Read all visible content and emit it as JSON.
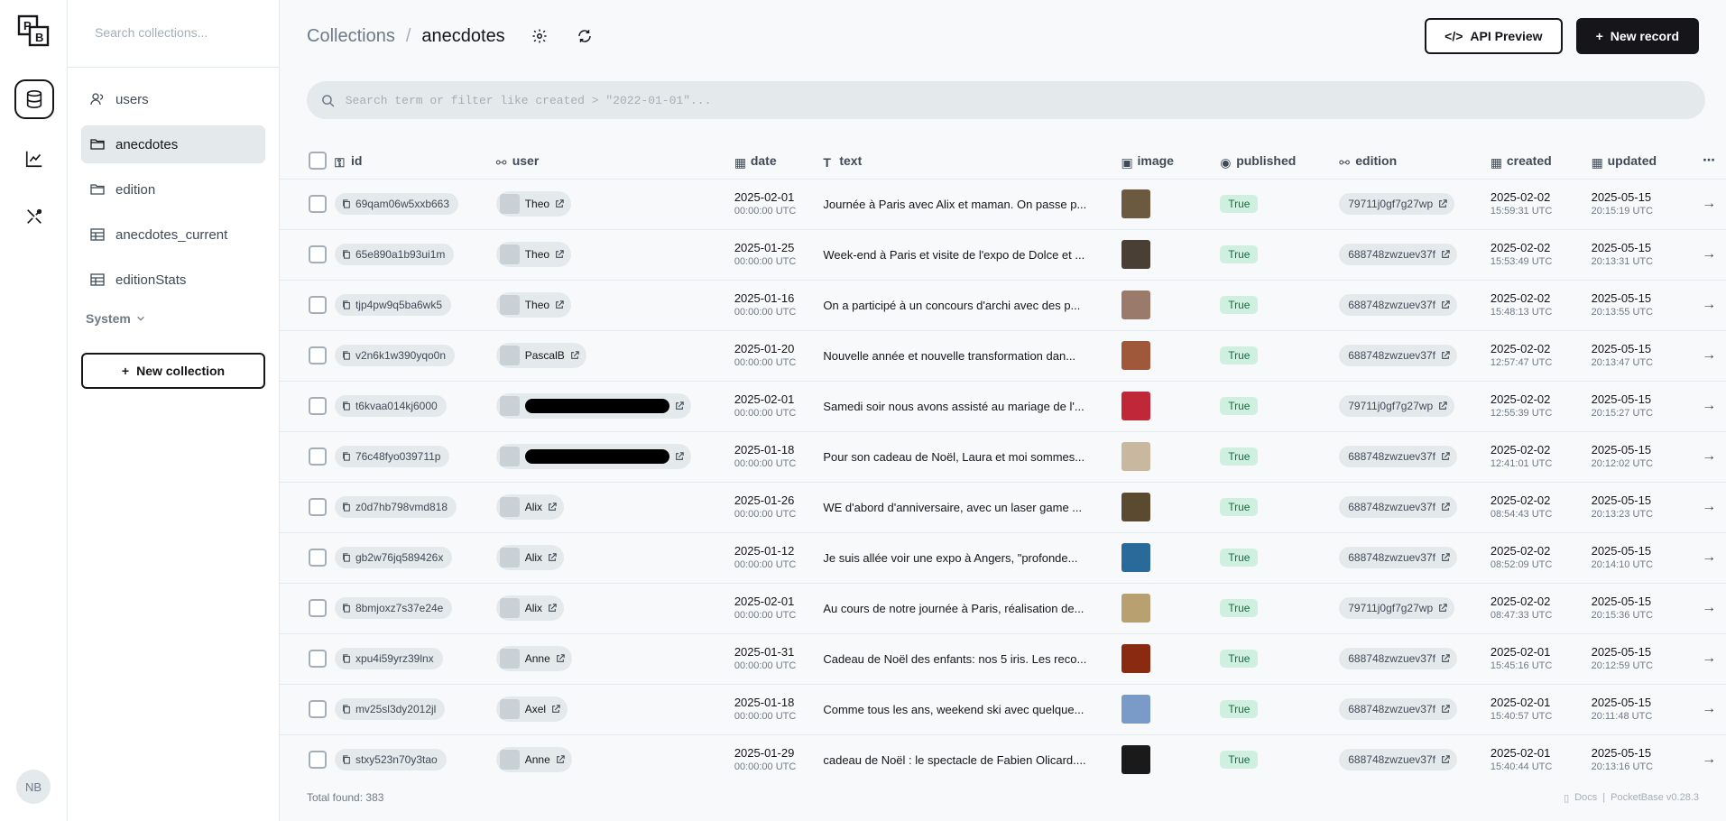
{
  "rail": {
    "logo_text": "PB",
    "items": [
      {
        "name": "collections",
        "icon": "database-icon",
        "active": true
      },
      {
        "name": "logs",
        "icon": "chart-line-icon",
        "active": false
      },
      {
        "name": "settings",
        "icon": "tools-icon",
        "active": false
      }
    ],
    "user_initials": "NB"
  },
  "sidebar": {
    "search_placeholder": "Search collections...",
    "collections": [
      {
        "label": "users",
        "icon": "user-icon",
        "active": false
      },
      {
        "label": "anecdotes",
        "icon": "folder-icon",
        "active": true
      },
      {
        "label": "edition",
        "icon": "folder-icon",
        "active": false
      },
      {
        "label": "anecdotes_current",
        "icon": "table-icon",
        "active": false
      },
      {
        "label": "editionStats",
        "icon": "table-icon",
        "active": false
      }
    ],
    "system_label": "System",
    "new_collection_label": "New collection"
  },
  "header": {
    "breadcrumb_root": "Collections",
    "breadcrumb_separator": "/",
    "breadcrumb_current": "anecdotes",
    "api_preview_label": "API Preview",
    "new_record_label": "New record"
  },
  "search": {
    "placeholder": "Search term or filter like created > \"2022-01-01\"..."
  },
  "table": {
    "columns": {
      "id": "id",
      "user": "user",
      "date": "date",
      "text": "text",
      "image": "image",
      "published": "published",
      "edition": "edition",
      "created": "created",
      "updated": "updated"
    },
    "rows": [
      {
        "id": "69qam06w5xxb663",
        "user": "Theo",
        "redacted": false,
        "date": "2025-02-01",
        "date_tz": "00:00:00 UTC",
        "text": "Journée à Paris avec Alix et maman. On passe p...",
        "thumb": "#6b5a3f",
        "published": "True",
        "edition": "79711j0gf7g27wp",
        "created": "2025-02-02",
        "created_time": "15:59:31 UTC",
        "updated": "2025-05-15",
        "updated_time": "20:15:19 UTC"
      },
      {
        "id": "65e890a1b93ui1m",
        "user": "Theo",
        "redacted": false,
        "date": "2025-01-25",
        "date_tz": "00:00:00 UTC",
        "text": "Week-end à Paris et visite de l'expo de Dolce et ...",
        "thumb": "#4a3f35",
        "published": "True",
        "edition": "688748zwzuev37f",
        "created": "2025-02-02",
        "created_time": "15:53:49 UTC",
        "updated": "2025-05-15",
        "updated_time": "20:13:31 UTC"
      },
      {
        "id": "tjp4pw9q5ba6wk5",
        "user": "Theo",
        "redacted": false,
        "date": "2025-01-16",
        "date_tz": "00:00:00 UTC",
        "text": "On a participé à un concours d'archi avec des p...",
        "thumb": "#9a7a6a",
        "published": "True",
        "edition": "688748zwzuev37f",
        "created": "2025-02-02",
        "created_time": "15:48:13 UTC",
        "updated": "2025-05-15",
        "updated_time": "20:13:55 UTC"
      },
      {
        "id": "v2n6k1w390yqo0n",
        "user": "PascalB",
        "redacted": false,
        "date": "2025-01-20",
        "date_tz": "00:00:00 UTC",
        "text": "Nouvelle année et nouvelle transformation dan...",
        "thumb": "#a0583a",
        "published": "True",
        "edition": "688748zwzuev37f",
        "created": "2025-02-02",
        "created_time": "12:57:47 UTC",
        "updated": "2025-05-15",
        "updated_time": "20:13:47 UTC"
      },
      {
        "id": "t6kvaa014kj6000",
        "user": "",
        "redacted": true,
        "date": "2025-02-01",
        "date_tz": "00:00:00 UTC",
        "text": "Samedi soir nous avons assisté au mariage de l'...",
        "thumb": "#c0283a",
        "published": "True",
        "edition": "79711j0gf7g27wp",
        "created": "2025-02-02",
        "created_time": "12:55:39 UTC",
        "updated": "2025-05-15",
        "updated_time": "20:15:27 UTC"
      },
      {
        "id": "76c48fyo039711p",
        "user": "",
        "redacted": true,
        "date": "2025-01-18",
        "date_tz": "00:00:00 UTC",
        "text": "Pour son cadeau de Noël, Laura et moi sommes...",
        "thumb": "#c8b8a0",
        "published": "True",
        "edition": "688748zwzuev37f",
        "created": "2025-02-02",
        "created_time": "12:41:01 UTC",
        "updated": "2025-05-15",
        "updated_time": "20:12:02 UTC"
      },
      {
        "id": "z0d7hb798vmd818",
        "user": "Alix",
        "redacted": false,
        "date": "2025-01-26",
        "date_tz": "00:00:00 UTC",
        "text": "WE d'abord d'anniversaire, avec un laser game ...",
        "thumb": "#5a4a30",
        "published": "True",
        "edition": "688748zwzuev37f",
        "created": "2025-02-02",
        "created_time": "08:54:43 UTC",
        "updated": "2025-05-15",
        "updated_time": "20:13:23 UTC"
      },
      {
        "id": "gb2w76jq589426x",
        "user": "Alix",
        "redacted": false,
        "date": "2025-01-12",
        "date_tz": "00:00:00 UTC",
        "text": "Je suis allée voir une expo à Angers, \"profonde...",
        "thumb": "#2a6a9a",
        "published": "True",
        "edition": "688748zwzuev37f",
        "created": "2025-02-02",
        "created_time": "08:52:09 UTC",
        "updated": "2025-05-15",
        "updated_time": "20:14:10 UTC"
      },
      {
        "id": "8bmjoxz7s37e24e",
        "user": "Alix",
        "redacted": false,
        "date": "2025-02-01",
        "date_tz": "00:00:00 UTC",
        "text": "Au cours de notre journée à Paris, réalisation de...",
        "thumb": "#b8a070",
        "published": "True",
        "edition": "79711j0gf7g27wp",
        "created": "2025-02-02",
        "created_time": "08:47:33 UTC",
        "updated": "2025-05-15",
        "updated_time": "20:15:36 UTC"
      },
      {
        "id": "xpu4i59yrz39lnx",
        "user": "Anne",
        "redacted": false,
        "date": "2025-01-31",
        "date_tz": "00:00:00 UTC",
        "text": "Cadeau de Noël des enfants: nos 5 iris. Les reco...",
        "thumb": "#8a2a10",
        "published": "True",
        "edition": "688748zwzuev37f",
        "created": "2025-02-01",
        "created_time": "15:45:16 UTC",
        "updated": "2025-05-15",
        "updated_time": "20:12:59 UTC"
      },
      {
        "id": "mv25sl3dy2012jl",
        "user": "Axel",
        "redacted": false,
        "date": "2025-01-18",
        "date_tz": "00:00:00 UTC",
        "text": "Comme tous les ans, weekend ski avec quelque...",
        "thumb": "#7a9ac8",
        "published": "True",
        "edition": "688748zwzuev37f",
        "created": "2025-02-01",
        "created_time": "15:40:57 UTC",
        "updated": "2025-05-15",
        "updated_time": "20:11:48 UTC"
      },
      {
        "id": "stxy523n70y3tao",
        "user": "Anne",
        "redacted": false,
        "date": "2025-01-29",
        "date_tz": "00:00:00 UTC",
        "text": "cadeau de Noël : le spectacle de Fabien Olicard....",
        "thumb": "#1a1a1a",
        "published": "True",
        "edition": "688748zwzuev37f",
        "created": "2025-02-01",
        "created_time": "15:40:44 UTC",
        "updated": "2025-05-15",
        "updated_time": "20:13:16 UTC"
      }
    ]
  },
  "footer": {
    "total_label": "Total found:",
    "total_value": "383",
    "docs_label": "Docs",
    "version_label": "PocketBase v0.28.3"
  }
}
